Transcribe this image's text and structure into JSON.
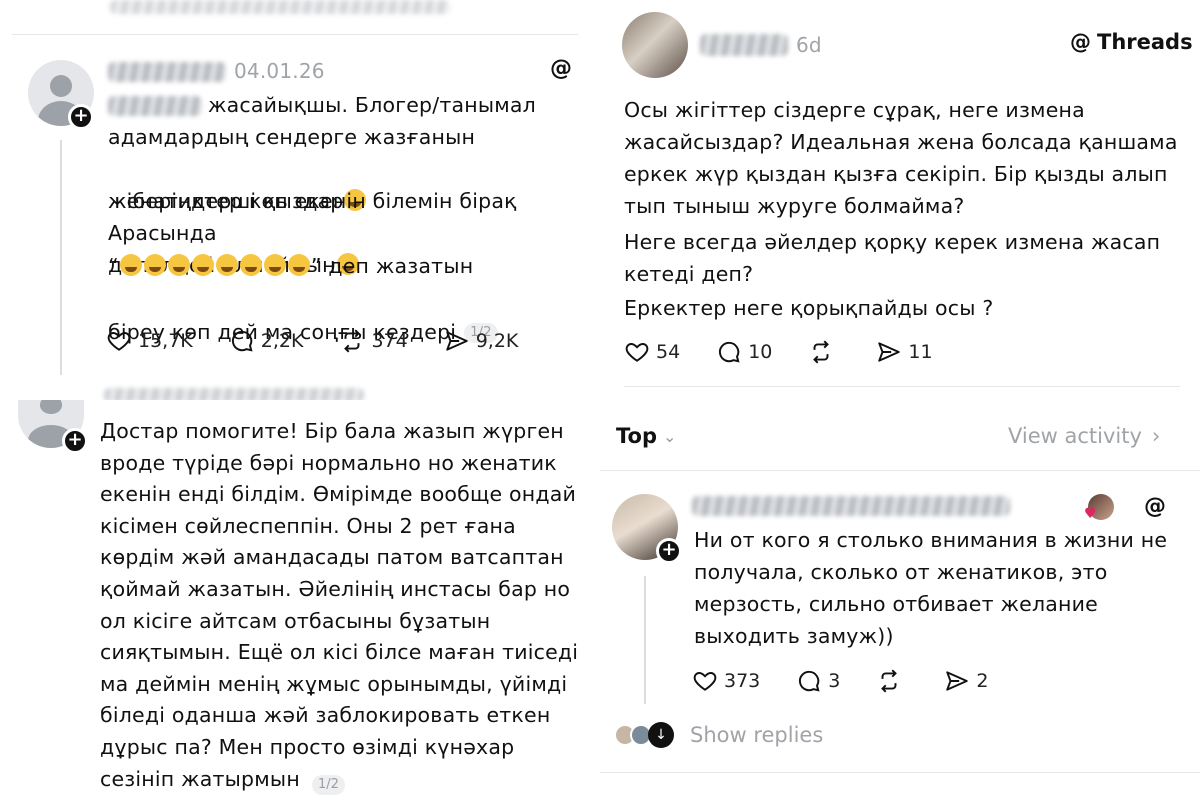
{
  "panel1": {
    "date": "04.01.26",
    "text_suffix": "жасайықшы. Блогер/танымал",
    "lines": [
      "адамдардың сендерге жазғанын",
      "жіберіңдерші қыздар",
      "Арасында",
      "женатиктер көп екенін білемін бірақ",
      "дәлелдей алмаймын",
      "деп жазатын",
      "біреу көп дей ма соңғы кездері"
    ],
    "page_badge": "1/2",
    "likes": "15,7K",
    "comments": "2,2K",
    "reposts": "374",
    "shares": "9,2K"
  },
  "panel2": {
    "time": "6d",
    "brand": "Threads",
    "paragraphs": [
      "Осы жігіттер сіздерге сұрақ, неге измена\nжасайсыздар? Идеальная жена болсада қаншама\nеркек жүр қыздан қызға секіріп. Бір қызды алып\nтып тыныш журуге болмайма?",
      "Неге всегда әйелдер қорқу керек измена жасап\nкетеді деп?",
      "Еркектер неге қорықпайды осы ?"
    ],
    "likes": "54",
    "comments": "10",
    "shares": "11",
    "sort_label": "Top",
    "view_activity": "View activity"
  },
  "panel3": {
    "text": "Достар помогите! Бір бала жазып жүрген\nвроде түріде бәрі нормально но женатик\nекенін енді білдім. Өмірімде вообще ондай\nкісімен сөйлеспеппін. Оны 2 рет ғана\nкөрдім жәй амандасады патом ватсаптан\nқоймай жазатын. Әйелінің инстасы бар но\nол кісіге айтсам отбасыны бұзатын\nсияқтымын. Ещё ол кісі білсе маған тиіседі\nма деймін менің жұмыс орынымды, үйімді\nбіледі оданша жәй заблокировать еткен\nдұрыс па? Мен просто өзімді күнәхар\nсезініп жатырмын",
    "page_badge": "1/2"
  },
  "panel4": {
    "text": "Ни от кого я столько внимания в жизни не\nполучала, сколько от женатиков, это\nмерзость, сильно отбивает желание\nвыходить замуж))",
    "likes": "373",
    "comments": "3",
    "shares": "2",
    "show_replies": "Show replies"
  }
}
